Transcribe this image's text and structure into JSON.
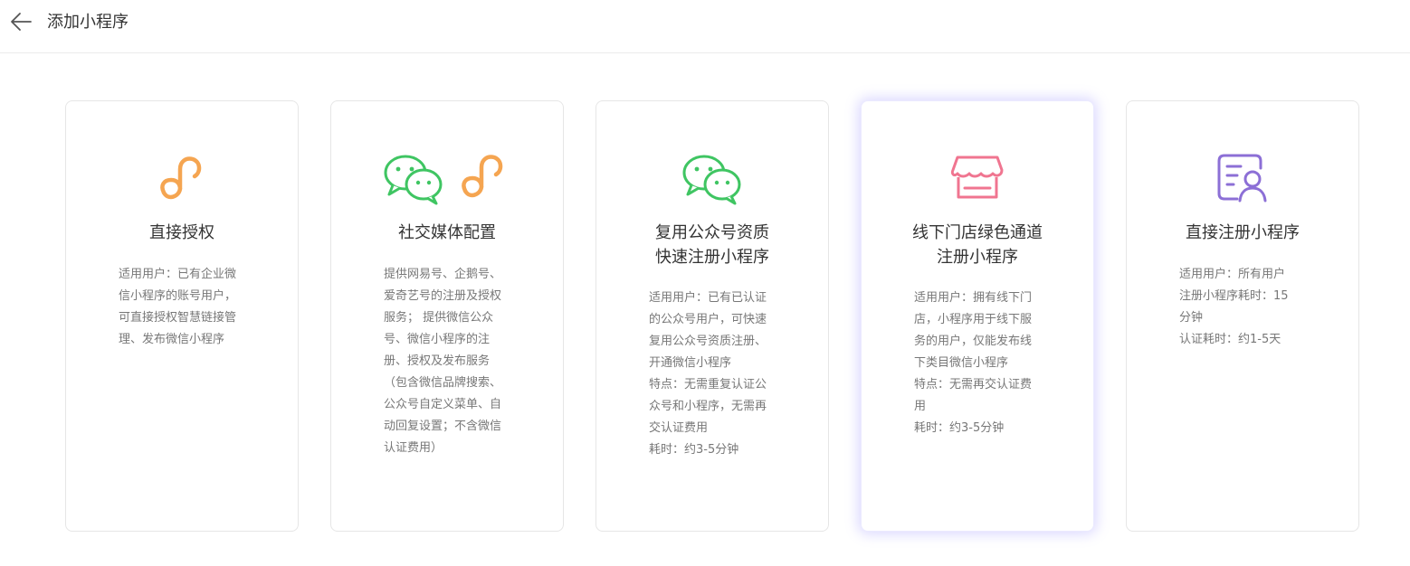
{
  "header": {
    "back_icon": "arrow-left-icon",
    "title": "添加小程序"
  },
  "cards": [
    {
      "icon": "mini-program-icon",
      "icon_color": "#f5a551",
      "title_lines": [
        "直接授权"
      ],
      "desc_lines": [
        "适用用户：已有企业微",
        "信小程序的账号用户，",
        "可直接授权智慧链接管",
        "理、发布微信小程序"
      ]
    },
    {
      "icon": "wechat-and-mini-program-icon",
      "icon_colors": [
        "#3fc562",
        "#f5a551"
      ],
      "title_lines": [
        "社交媒体配置"
      ],
      "desc_lines": [
        "提供网易号、企鹅号、",
        "爱奇艺号的注册及授权",
        "服务； 提供微信公众",
        "号、微信小程序的注",
        "册、授权及发布服务",
        "（包含微信品牌搜索、",
        "公众号自定义菜单、自",
        "动回复设置；不含微信",
        "认证费用）"
      ]
    },
    {
      "icon": "wechat-icon",
      "icon_color": "#3fc562",
      "title_lines": [
        "复用公众号资质",
        "快速注册小程序"
      ],
      "desc_lines": [
        "适用用户：已有已认证",
        "的公众号用户，可快速",
        "复用公众号资质注册、",
        "开通微信小程序",
        "特点：无需重复认证公",
        "众号和小程序，无需再",
        "交认证费用",
        "耗时：约3-5分钟"
      ]
    },
    {
      "icon": "store-icon",
      "icon_color": "#f07590",
      "selected": true,
      "title_lines": [
        "线下门店绿色通道",
        "注册小程序"
      ],
      "desc_lines": [
        "适用用户：拥有线下门",
        "店，小程序用于线下服",
        "务的用户，仅能发布线",
        "下类目微信小程序",
        "特点：无需再交认证费",
        "用",
        "耗时：约3-5分钟"
      ]
    },
    {
      "icon": "user-register-icon",
      "icon_color": "#8c6fd6",
      "title_lines": [
        "直接注册小程序"
      ],
      "desc_lines": [
        "适用用户：所有用户",
        "注册小程序耗时：15",
        "分钟",
        "认证耗时：约1-5天"
      ]
    }
  ]
}
